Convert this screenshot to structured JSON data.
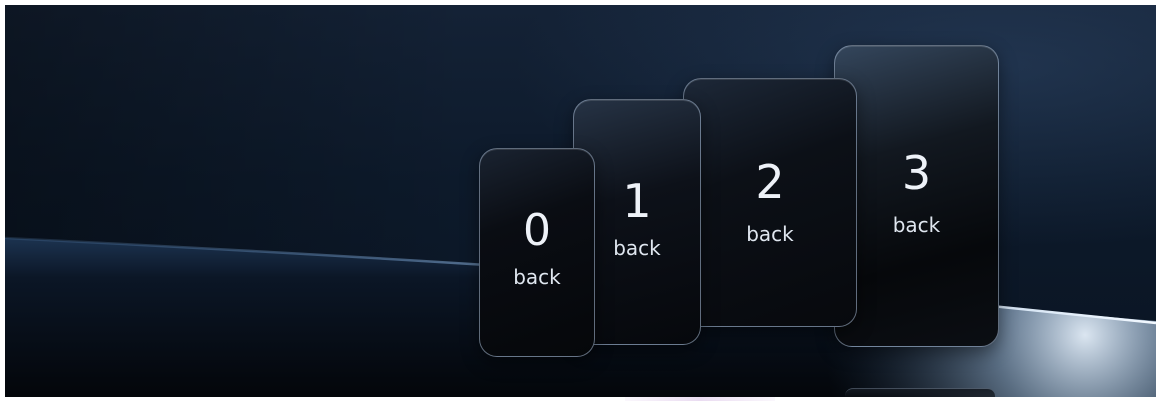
{
  "cards": [
    {
      "number": "0",
      "label": "back"
    },
    {
      "number": "1",
      "label": "back"
    },
    {
      "number": "2",
      "label": "back"
    },
    {
      "number": "3",
      "label": "back"
    }
  ],
  "colors": {
    "background_top": "#142236",
    "background_bottom": "#0a1422",
    "card_fill": "#05070a",
    "card_border": "#aabed7",
    "text": "#eef2f8",
    "horizon_glow": "#cfe3f7"
  }
}
